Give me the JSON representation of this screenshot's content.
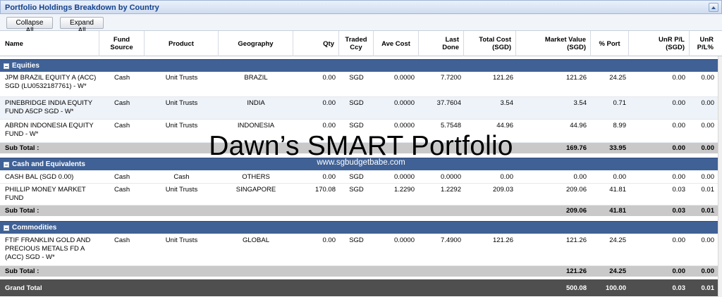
{
  "panel": {
    "title": "Portfolio Holdings Breakdown by Country"
  },
  "toolbar": {
    "collapse_label": "Collapse All",
    "expand_label": "Expand All"
  },
  "columns": {
    "name": "Name",
    "fund_source": "Fund\nSource",
    "product": "Product",
    "geography": "Geography",
    "qty": "Qty",
    "traded_ccy": "Traded\nCcy",
    "ave_cost": "Ave Cost",
    "last_done": "Last\nDone",
    "total_cost": "Total Cost\n(SGD)",
    "market_value": "Market Value\n(SGD)",
    "pct_port": "% Port",
    "unr_pl": "UnR P/L\n(SGD)",
    "unr_pl_pct": "UnR\nP/L%"
  },
  "groups": [
    {
      "label": "Equities",
      "rows": [
        {
          "name": "JPM BRAZIL EQUITY A (ACC) SGD (LU0532187761) - W*",
          "fund_source": "Cash",
          "product": "Unit Trusts",
          "geography": "BRAZIL",
          "qty": "0.00",
          "ccy": "SGD",
          "ave_cost": "0.0000",
          "last_done": "7.7200",
          "total_cost": "121.26",
          "market_value": "121.26",
          "pct_port": "24.25",
          "unr_pl": "0.00",
          "unr_pl_pct": "0.00"
        },
        {
          "name": "PINEBRIDGE INDIA EQUITY FUND A5CP SGD - W*",
          "fund_source": "Cash",
          "product": "Unit Trusts",
          "geography": "INDIA",
          "qty": "0.00",
          "ccy": "SGD",
          "ave_cost": "0.0000",
          "last_done": "37.7604",
          "total_cost": "3.54",
          "market_value": "3.54",
          "pct_port": "0.71",
          "unr_pl": "0.00",
          "unr_pl_pct": "0.00"
        },
        {
          "name": "ABRDN INDONESIA EQUITY FUND - W*",
          "fund_source": "Cash",
          "product": "Unit Trusts",
          "geography": "INDONESIA",
          "qty": "0.00",
          "ccy": "SGD",
          "ave_cost": "0.0000",
          "last_done": "5.7548",
          "total_cost": "44.96",
          "market_value": "44.96",
          "pct_port": "8.99",
          "unr_pl": "0.00",
          "unr_pl_pct": "0.00"
        }
      ],
      "subtotal": {
        "label": "Sub Total :",
        "market_value": "169.76",
        "pct_port": "33.95",
        "unr_pl": "0.00",
        "unr_pl_pct": "0.00"
      }
    },
    {
      "label": "Cash and Equivalents",
      "rows": [
        {
          "name": "CASH BAL (SGD 0.00)",
          "fund_source": "Cash",
          "product": "Cash",
          "geography": "OTHERS",
          "qty": "0.00",
          "ccy": "SGD",
          "ave_cost": "0.0000",
          "last_done": "0.0000",
          "total_cost": "0.00",
          "market_value": "0.00",
          "pct_port": "0.00",
          "unr_pl": "0.00",
          "unr_pl_pct": "0.00"
        },
        {
          "name": "PHILLIP MONEY MARKET FUND",
          "fund_source": "Cash",
          "product": "Unit Trusts",
          "geography": "SINGAPORE",
          "qty": "170.08",
          "ccy": "SGD",
          "ave_cost": "1.2290",
          "last_done": "1.2292",
          "total_cost": "209.03",
          "market_value": "209.06",
          "pct_port": "41.81",
          "unr_pl": "0.03",
          "unr_pl_pct": "0.01"
        }
      ],
      "subtotal": {
        "label": "Sub Total :",
        "market_value": "209.06",
        "pct_port": "41.81",
        "unr_pl": "0.03",
        "unr_pl_pct": "0.01"
      }
    },
    {
      "label": "Commodities",
      "rows": [
        {
          "name": "FTIF FRANKLIN GOLD AND PRECIOUS METALS FD A (ACC) SGD - W*",
          "fund_source": "Cash",
          "product": "Unit Trusts",
          "geography": "GLOBAL",
          "qty": "0.00",
          "ccy": "SGD",
          "ave_cost": "0.0000",
          "last_done": "7.4900",
          "total_cost": "121.26",
          "market_value": "121.26",
          "pct_port": "24.25",
          "unr_pl": "0.00",
          "unr_pl_pct": "0.00"
        }
      ],
      "subtotal": {
        "label": "Sub Total :",
        "market_value": "121.26",
        "pct_port": "24.25",
        "unr_pl": "0.00",
        "unr_pl_pct": "0.00"
      }
    }
  ],
  "grand_total": {
    "label": "Grand Total",
    "market_value": "500.08",
    "pct_port": "100.00",
    "unr_pl": "0.03",
    "unr_pl_pct": "0.01"
  },
  "watermark": {
    "title": "Dawn’s SMART Portfolio",
    "url": "www.sgbudgetbabe.com"
  },
  "colors": {
    "group_header": "#3f6196",
    "title_text": "#15428b",
    "subtotal_bg": "#c9c9c9",
    "grand_total_bg": "#4f4f4f"
  },
  "icons": {
    "collapse_tool": "collapse-up-icon",
    "group_toggle": "minus-square-icon"
  }
}
